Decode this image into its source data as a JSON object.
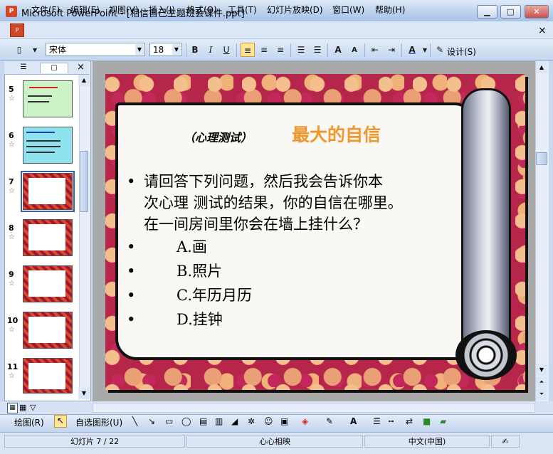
{
  "window": {
    "title": "Microsoft PowerPoint - [相信自己主题班会课件.ppt]",
    "app_icon_text": "P",
    "minimize": "▁",
    "maximize": "□",
    "close": "✕"
  },
  "menu": {
    "doc_icon_text": "P",
    "items": [
      "文件(F)",
      "编辑(E)",
      "视图(V)",
      "插入(I)",
      "格式(O)",
      "工具(T)",
      "幻灯片放映(D)",
      "窗口(W)",
      "帮助(H)"
    ],
    "close_doc": "×"
  },
  "toolbar": {
    "font_name": "宋体",
    "font_size": "18",
    "bold": "B",
    "italic": "I",
    "underline": "U",
    "design": "设计(S)"
  },
  "left_pane": {
    "close": "×",
    "slides": [
      {
        "number": "5",
        "star": "☆"
      },
      {
        "number": "6",
        "star": "☆"
      },
      {
        "number": "7",
        "star": "☆"
      },
      {
        "number": "8",
        "star": "☆"
      },
      {
        "number": "9",
        "star": "☆"
      },
      {
        "number": "10",
        "star": "☆"
      },
      {
        "number": "11",
        "star": "☆"
      }
    ]
  },
  "slide": {
    "subtitle": "（心理测试）",
    "title": "最大的自信",
    "bullet_symbol": "•",
    "question_lines": [
      "请回答下列问题，然后我会告诉你本",
      "次心理 测试的结果，你的自信在哪里。",
      "在一间房间里你会在墙上挂什么？"
    ],
    "options": [
      "A.画",
      "B.照片",
      "C.年历月历",
      "D.挂钟"
    ]
  },
  "drawing_toolbar": {
    "draw_menu": "绘图(R)",
    "autoshapes": "自选图形(U)"
  },
  "status": {
    "slide_position": "幻灯片 7 / 22",
    "design_template": "心心相映",
    "language": "中文(中国)"
  }
}
